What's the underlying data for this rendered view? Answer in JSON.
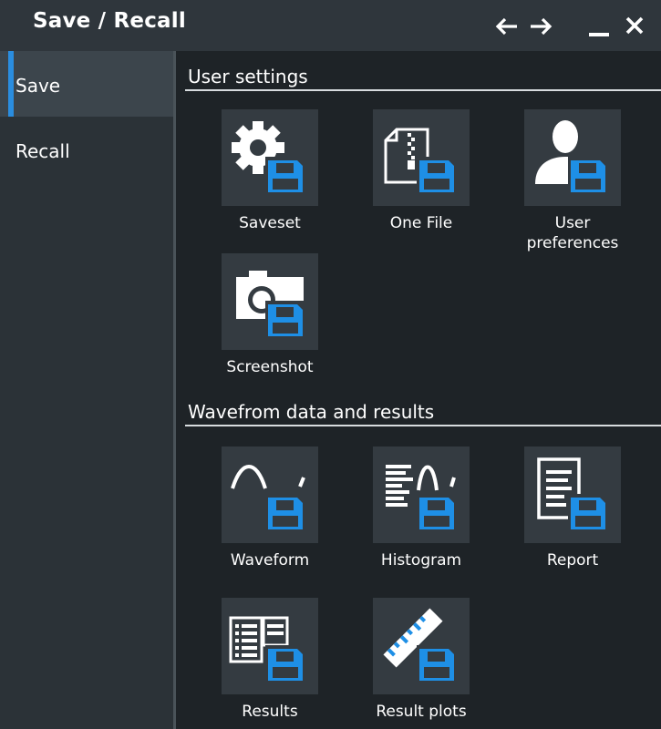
{
  "window": {
    "title": "Save / Recall",
    "controls": [
      "arrow-left-icon",
      "arrow-right-icon",
      "minimize-icon",
      "close-icon"
    ]
  },
  "sidebar": {
    "items": [
      {
        "label": "Save",
        "active": true
      },
      {
        "label": "Recall",
        "active": false
      }
    ]
  },
  "sections": [
    {
      "title": "User settings",
      "tiles": [
        {
          "label": "Saveset",
          "icon": "gear-save-icon"
        },
        {
          "label": "One File",
          "icon": "file-zip-save-icon"
        },
        {
          "label": "User\npreferences",
          "icon": "user-save-icon"
        },
        {
          "label": "Screenshot",
          "icon": "camera-save-icon"
        }
      ]
    },
    {
      "title": "Wavefrom data and results",
      "tiles": [
        {
          "label": "Waveform",
          "icon": "waveform-save-icon"
        },
        {
          "label": "Histogram",
          "icon": "histogram-save-icon"
        },
        {
          "label": "Report",
          "icon": "report-save-icon"
        },
        {
          "label": "Results",
          "icon": "results-table-save-icon"
        },
        {
          "label": "Result plots",
          "icon": "ruler-save-icon"
        }
      ]
    }
  ],
  "colors": {
    "accent": "#2a8ddf",
    "floppy": "#1e8fe6",
    "tile_bg": "#343b41",
    "panel_bg": "#1e2327",
    "titlebar_bg": "#2f363c"
  }
}
